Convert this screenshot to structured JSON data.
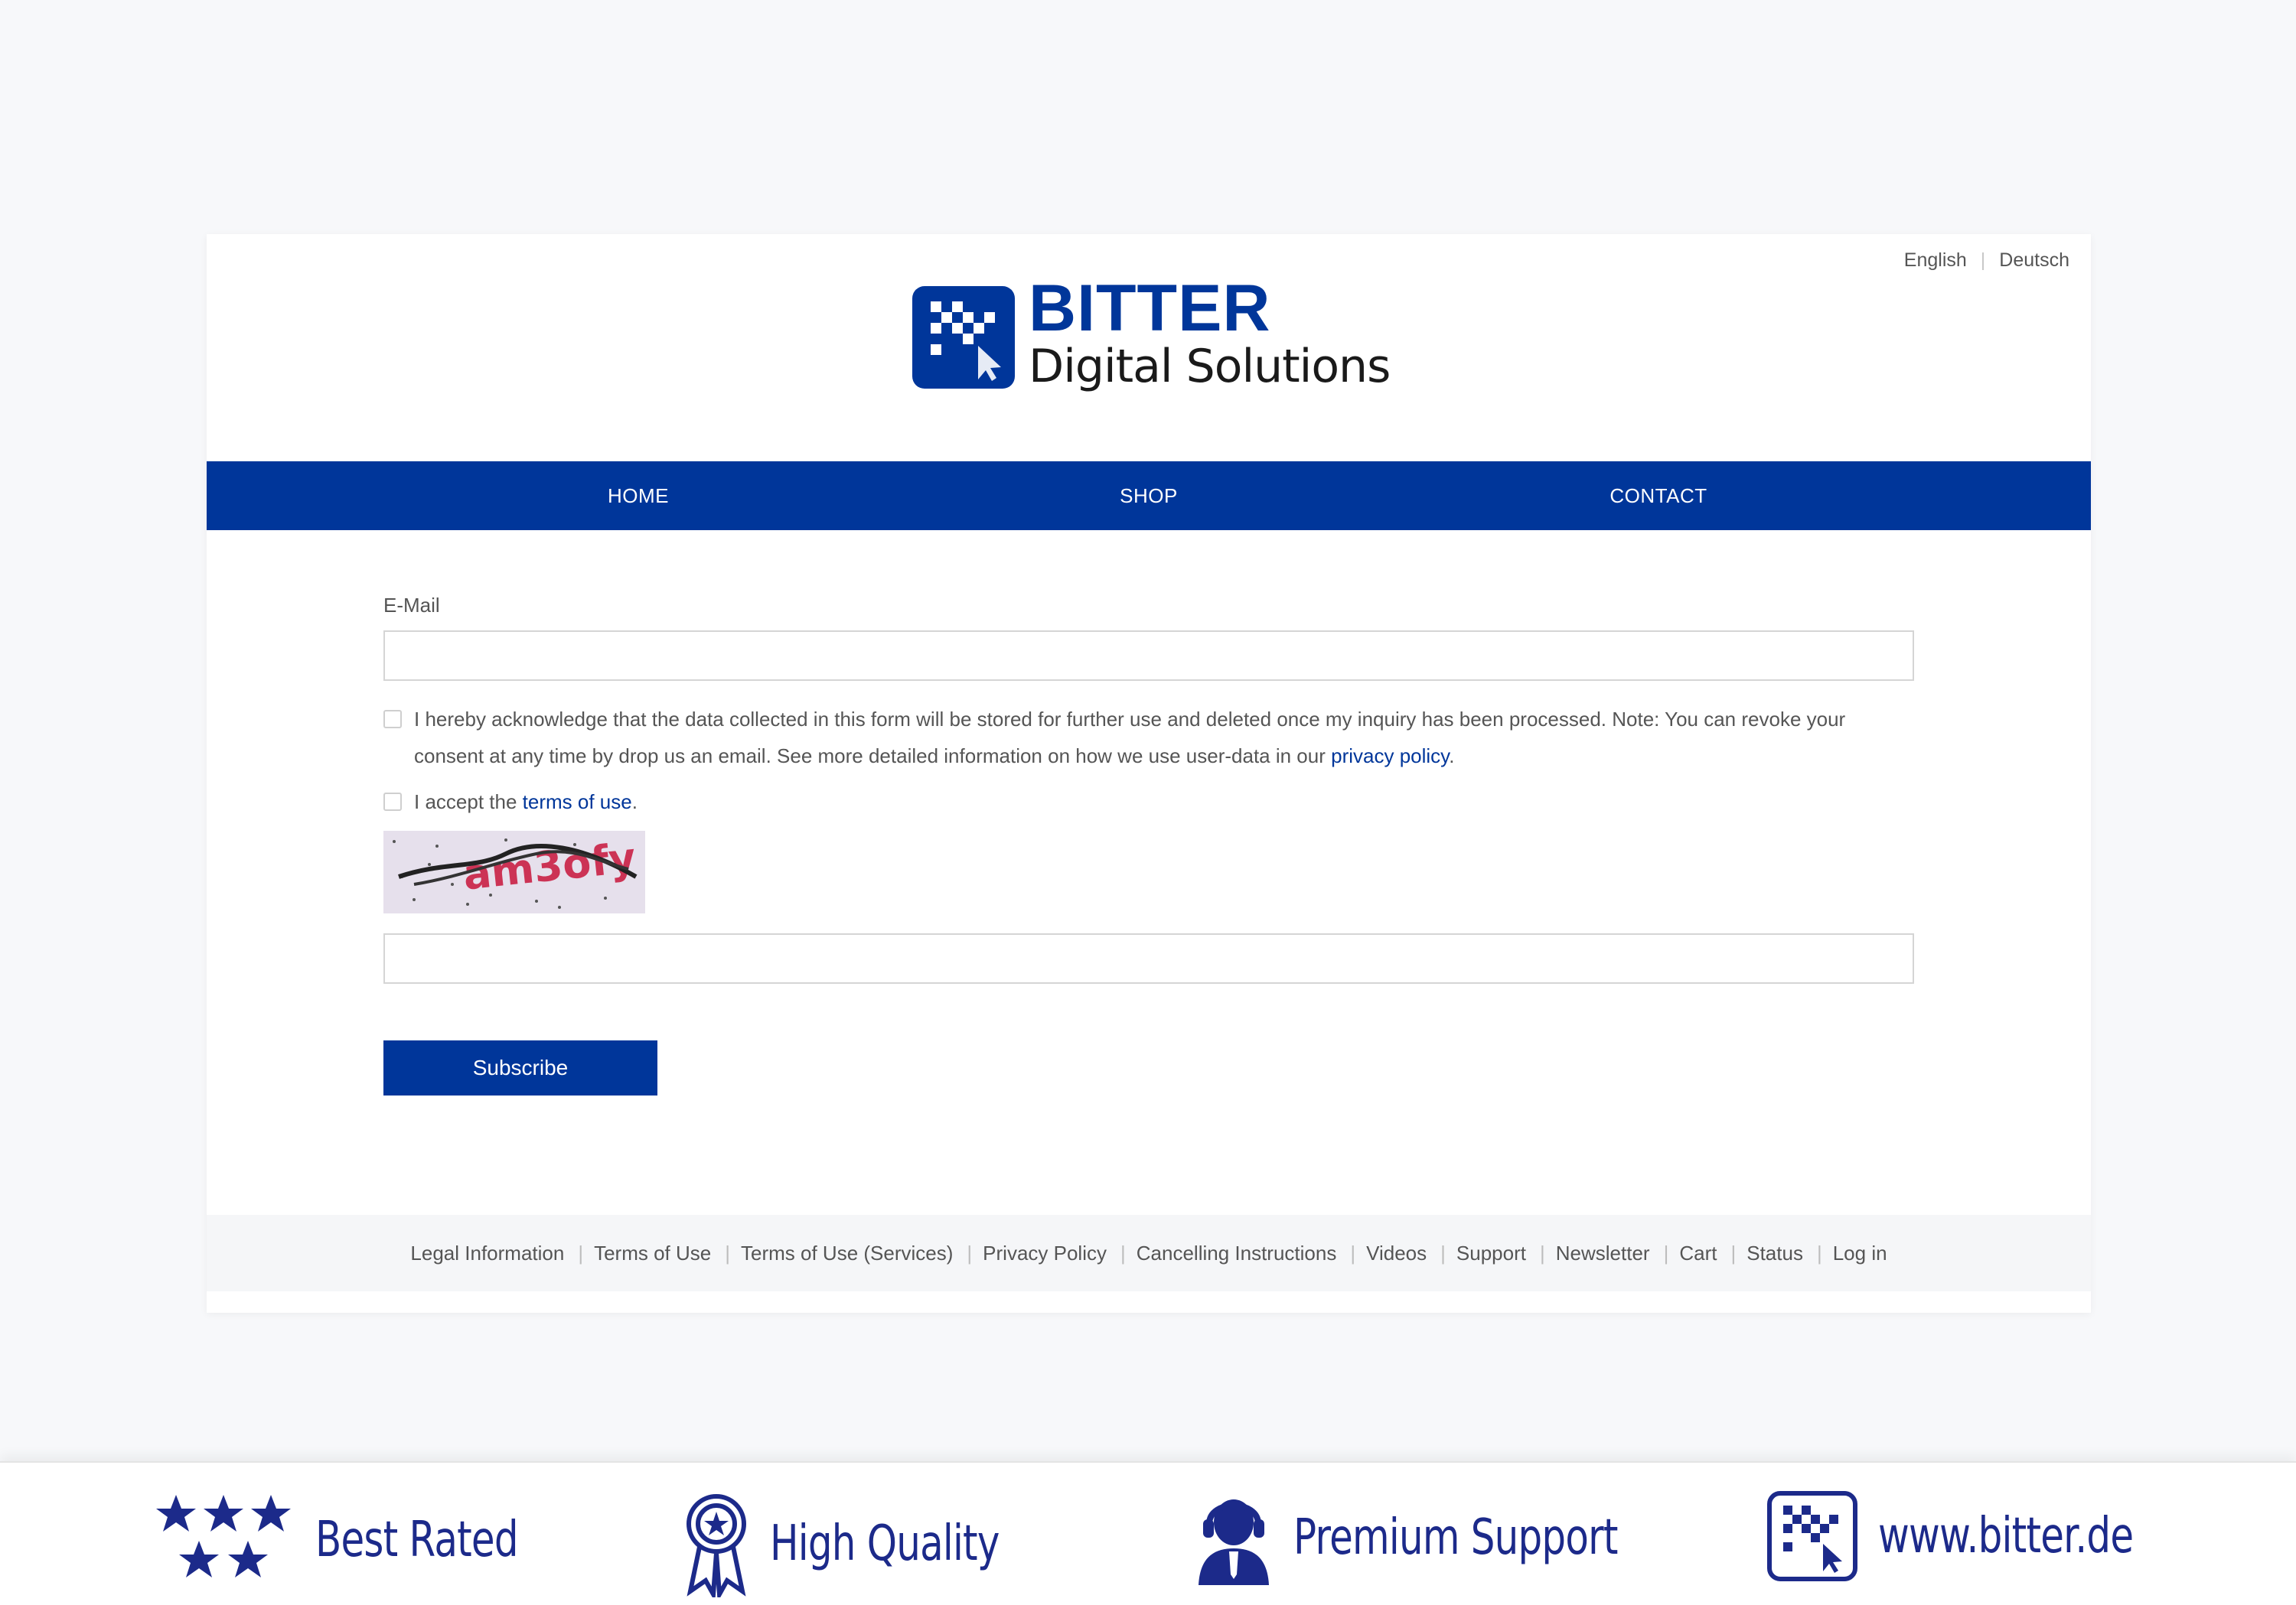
{
  "languages": [
    "English",
    "Deutsch"
  ],
  "brand": {
    "name": "BITTER",
    "subtitle": "Digital Solutions",
    "color": "#00369a"
  },
  "nav": {
    "items": [
      "HOME",
      "SHOP",
      "CONTACT"
    ]
  },
  "form": {
    "email_label": "E-Mail",
    "email_value": "",
    "consent": {
      "text": "I hereby acknowledge that the data collected in this form will be stored for further use and deleted once my inquiry has been processed. Note: You can revoke your consent at any time by drop us an email. See more detailed information on how we use user-data in our",
      "link": "privacy policy",
      "suffix": ".",
      "checked": false
    },
    "terms": {
      "prefix": "I accept the",
      "link": "terms of use",
      "suffix": ".",
      "checked": false
    },
    "captcha_text": "am3ofy",
    "captcha_value": "",
    "submit_label": "Subscribe"
  },
  "footer": {
    "links": [
      "Legal Information",
      "Terms of Use",
      "Terms of Use (Services)",
      "Privacy Policy",
      "Cancelling Instructions",
      "Videos",
      "Support",
      "Newsletter",
      "Cart",
      "Status",
      "Log in"
    ]
  },
  "banner": {
    "badges": [
      {
        "icon": "stars-icon",
        "label": "Best Rated"
      },
      {
        "icon": "award-ribbon-icon",
        "label": "High Quality"
      },
      {
        "icon": "support-agent-icon",
        "label": "Premium Support"
      },
      {
        "icon": "bitter-logo-icon",
        "label": "www.bitter.de"
      }
    ]
  }
}
